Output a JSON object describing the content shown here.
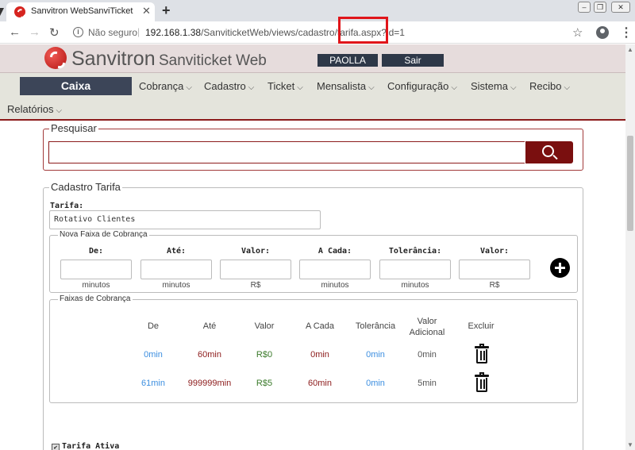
{
  "browser": {
    "tab_title": "Sanvitron WebSanviTicket",
    "tab_close": "✕",
    "new_tab": "+",
    "insecure_label": "Não seguro",
    "url_host": "192.168.1.38",
    "url_path": "/SanviticketWeb/views/cadastro/tarifa.aspx?id=1",
    "url_separator": "|"
  },
  "header": {
    "brand": "Sanvitron",
    "brand_sub": "Sanviticket Web",
    "user_button": "PAOLLA",
    "logout_button": "Sair"
  },
  "menu": {
    "caixa": "Caixa",
    "items": [
      "Cobrança",
      "Cadastro",
      "Ticket",
      "Mensalista",
      "Configuração",
      "Sistema",
      "Recibo",
      "Relatórios"
    ]
  },
  "search": {
    "legend": "Pesquisar",
    "value": ""
  },
  "cadastro": {
    "legend": "Cadastro Tarifa",
    "tarifa_label": "Tarifa:",
    "tarifa_value": "Rotativo Clientes",
    "nova_faixa": {
      "legend": "Nova Faixa de Cobrança",
      "fields": [
        {
          "label": "De:",
          "unit": "minutos"
        },
        {
          "label": "Até:",
          "unit": "minutos"
        },
        {
          "label": "Valor:",
          "unit": "R$"
        },
        {
          "label": "A Cada:",
          "unit": "minutos"
        },
        {
          "label": "Tolerância:",
          "unit": "minutos"
        },
        {
          "label": "Valor:",
          "unit": "R$"
        }
      ]
    },
    "faixas": {
      "legend": "Faixas de Cobrança",
      "columns": [
        "De",
        "Até",
        "Valor",
        "A Cada",
        "Tolerância",
        "Valor Adicional",
        "Excluir"
      ],
      "rows": [
        [
          "0min",
          "60min",
          "R$0",
          "0min",
          "0min",
          "0min"
        ],
        [
          "61min",
          "999999min",
          "R$5",
          "60min",
          "0min",
          "5min"
        ]
      ]
    },
    "ativa_label": "Tarifa Ativa",
    "ativa_checked": true
  },
  "colors": {
    "brand_red": "#8c1b1b",
    "header_bg": "#e6dcdc",
    "menu_bg": "#e4e4dc",
    "button_dark": "#2e3848"
  }
}
